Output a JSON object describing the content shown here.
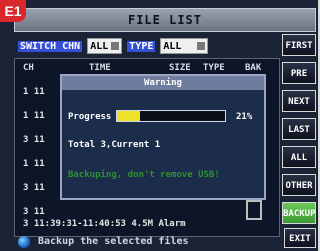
{
  "badge": "E1",
  "title": "FILE LIST",
  "filters": {
    "switch_label": "SWITCH CHN",
    "switch_value": "ALL",
    "type_label": "TYPE",
    "type_value": "ALL"
  },
  "columns": {
    "ch": "CH",
    "time": "TIME",
    "size": "SIZE",
    "type": "TYPE",
    "bak": "BAK"
  },
  "rows": [
    "1 11",
    "1 11",
    "3 11",
    "1 11",
    "3 11",
    "3 11",
    "3 11:39:31-11:40:53   4.5M Alarm"
  ],
  "sidebar": [
    "FIRST",
    "PRE",
    "NEXT",
    "LAST",
    "ALL",
    "OTHER",
    "BACKUP"
  ],
  "exit_label": "EXIT",
  "dialog": {
    "title": "Warning",
    "progress_label": "Progress",
    "progress_percent": "21%",
    "progress_fraction": 0.21,
    "total_text": "Total 3,Current 1",
    "status_text": "Backuping, don't remove USB!"
  },
  "footer": {
    "text": "Backup the selected files"
  },
  "colors": {
    "progress_fill": "#efe22a",
    "active_button": "#4aae3e",
    "status_text": "#2f8f2f"
  }
}
